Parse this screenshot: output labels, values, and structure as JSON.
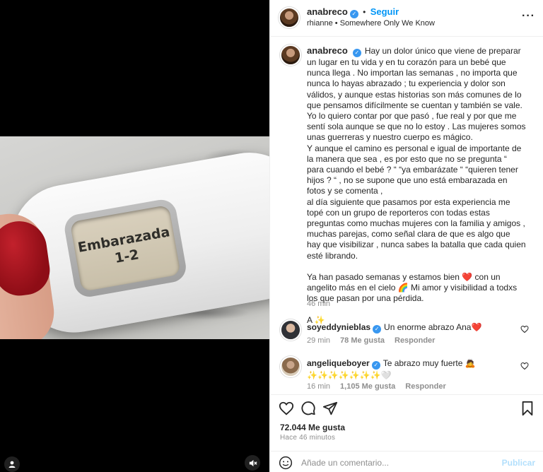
{
  "media": {
    "test_text_line1": "Embarazada",
    "test_text_line2": "1-2"
  },
  "header": {
    "username": "anabreco",
    "follow_label": "Seguir",
    "music_artist": "rhianne",
    "music_separator": "•",
    "music_title": "Somewhere Only We Know",
    "more_label": "···"
  },
  "caption": {
    "username": "anabreco",
    "text": "Hay un dolor único que viene de preparar un lugar en tu vida y en tu corazón para un bebé que nunca llega . No importan las semanas , no importa que nunca lo hayas abrazado ; tu experiencia y dolor son válidos, y aunque estas historias son más comunes de lo que pensamos difícilmente se cuentan y también se vale.\nYo lo quiero contar por que pasó , fue real y por que me sentí sola aunque se que no lo estoy . Las mujeres somos unas guerreras y nuestro cuerpo es mágico.\nY aunque el camino es personal e igual de importante de la manera que sea , es por esto que no se pregunta “ para cuando el bebé ? “ “ya embarázate “ “quieren tener hijos ? “ , no se supone que uno está embarazada en fotos y se comenta ,\nal día siguiente que pasamos por esta experiencia me topé con un grupo de reporteros con todas estas preguntas como muchas mujeres con la familia y amigos , muchas parejas, como señal clara de que es algo que hay que visibilizar , nunca sabes la batalla que cada quien esté librando.\n\nYa han pasado semanas y estamos bien ❤️ con un angelito más en el cielo 🌈 Mi amor y visibilidad a todxs los que pasan por una pérdida.\n\nA ✨",
    "time": "46 min"
  },
  "comments": [
    {
      "username": "soyeddynieblas",
      "text": "Un enorme abrazo Ana❤️",
      "time": "29 min",
      "likes": "78 Me gusta",
      "reply": "Responder"
    },
    {
      "username": "angeliqueboyer",
      "text": "Te abrazo muy fuerte 🙇",
      "text2": "✨✨✨✨✨✨✨🤍",
      "time": "16 min",
      "likes": "1,105 Me gusta",
      "reply": "Responder"
    }
  ],
  "footer": {
    "likes": "72.044 Me gusta",
    "ago": "Hace 46 minutos",
    "comment_placeholder": "Añade un comentario...",
    "post_label": "Publicar"
  },
  "colors": {
    "accent": "#0095f6",
    "verified": "#3897f0",
    "muted": "#8e8e8e"
  }
}
